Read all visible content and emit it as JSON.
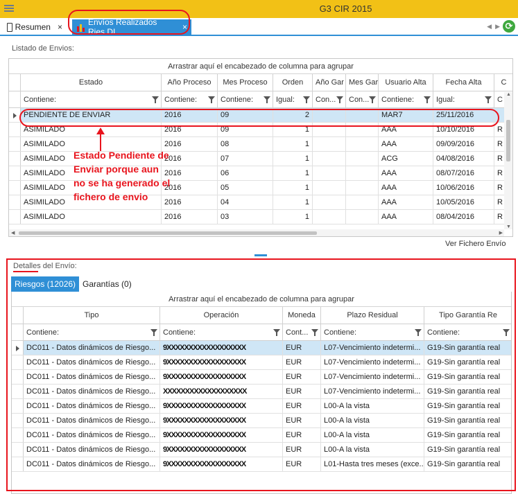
{
  "app": {
    "title": "G3 CIR 2015"
  },
  "tabs": [
    {
      "label": "Resumen",
      "close": "×"
    },
    {
      "label": "Envíos Realizados Ries DI",
      "close": "×"
    }
  ],
  "envios": {
    "panel_title": "Listado de Envios:",
    "group_hint": "Arrastrar aquí el encabezado de columna para agrupar",
    "columns": [
      "Estado",
      "Año Proceso",
      "Mes Proceso",
      "Orden",
      "Año Gar",
      "Mes Gar",
      "Usuario Alta",
      "Fecha Alta",
      "C"
    ],
    "filters": [
      "Contiene:",
      "Contiene:",
      "Contiene:",
      "Igual:",
      "Con...",
      "Con...",
      "Contiene:",
      "Igual:",
      "C"
    ],
    "rows": [
      [
        "PENDIENTE DE ENVIAR",
        "2016",
        "09",
        "2",
        "",
        "",
        "MAR7",
        "25/11/2016",
        ""
      ],
      [
        "ASIMILADO",
        "2016",
        "09",
        "1",
        "",
        "",
        "AAA",
        "10/10/2016",
        "R"
      ],
      [
        "ASIMILADO",
        "2016",
        "08",
        "1",
        "",
        "",
        "AAA",
        "09/09/2016",
        "R"
      ],
      [
        "ASIMILADO",
        "2016",
        "07",
        "1",
        "",
        "",
        "ACG",
        "04/08/2016",
        "R"
      ],
      [
        "ASIMILADO",
        "2016",
        "06",
        "1",
        "",
        "",
        "AAA",
        "08/07/2016",
        "R"
      ],
      [
        "ASIMILADO",
        "2016",
        "05",
        "1",
        "",
        "",
        "AAA",
        "10/06/2016",
        "R"
      ],
      [
        "ASIMILADO",
        "2016",
        "04",
        "1",
        "",
        "",
        "AAA",
        "10/05/2016",
        "R"
      ],
      [
        "ASIMILADO",
        "2016",
        "03",
        "1",
        "",
        "",
        "AAA",
        "08/04/2016",
        "R"
      ]
    ],
    "link": "Ver Fichero Envío"
  },
  "annotation": {
    "text": "Estado Pendiente de Enviar porque aun no se ha generado el fichero de envio"
  },
  "detalles": {
    "panel_title": "Detalles del Envío:",
    "subtabs": [
      "Riesgos (12026)",
      "Garantías (0)"
    ],
    "group_hint": "Arrastrar aquí el encabezado de columna para agrupar",
    "columns": [
      "Tipo",
      "Operación",
      "Moneda",
      "Plazo Residual",
      "Tipo Garantía Re"
    ],
    "filters": [
      "Contiene:",
      "Contiene:",
      "Cont...",
      "Contiene:",
      "Contiene:"
    ],
    "rows": [
      [
        "DC011 - Datos dinámicos de Riesgo...",
        "9XXXXXXXXXXXXXXXXXX",
        "EUR",
        "L07-Vencimiento indetermi...",
        "G19-Sin garantía real"
      ],
      [
        "DC011 - Datos dinámicos de Riesgo...",
        "9XXXXXXXXXXXXXXXXXX",
        "EUR",
        "L07-Vencimiento indetermi...",
        "G19-Sin garantía real"
      ],
      [
        "DC011 - Datos dinámicos de Riesgo...",
        "9XXXXXXXXXXXXXXXXXX",
        "EUR",
        "L07-Vencimiento indetermi...",
        "G19-Sin garantía real"
      ],
      [
        "DC011 - Datos dinámicos de Riesgo...",
        "XXXXXXXXXXXXXXXXXXX",
        "EUR",
        "L07-Vencimiento indetermi...",
        "G19-Sin garantía real"
      ],
      [
        "DC011 - Datos dinámicos de Riesgo...",
        "9XXXXXXXXXXXXXXXXXX",
        "EUR",
        "L00-A la vista",
        "G19-Sin garantía real"
      ],
      [
        "DC011 - Datos dinámicos de Riesgo...",
        "9XXXXXXXXXXXXXXXXXX",
        "EUR",
        "L00-A la vista",
        "G19-Sin garantía real"
      ],
      [
        "DC011 - Datos dinámicos de Riesgo...",
        "9XXXXXXXXXXXXXXXXXX",
        "EUR",
        "L00-A la vista",
        "G19-Sin garantía real"
      ],
      [
        "DC011 - Datos dinámicos de Riesgo...",
        "9XXXXXXXXXXXXXXXXXX",
        "EUR",
        "L00-A la vista",
        "G19-Sin garantía real"
      ],
      [
        "DC011 - Datos dinámicos de Riesgo...",
        "9XXXXXXXXXXXXXXXXXX",
        "EUR",
        "L01-Hasta tres meses (exce...",
        "G19-Sin garantía real"
      ]
    ]
  },
  "colors": {
    "accent": "#2f8fd6",
    "titlebar": "#f2c116",
    "annotation": "#e8141d",
    "selected_row": "#cfe6f6"
  }
}
